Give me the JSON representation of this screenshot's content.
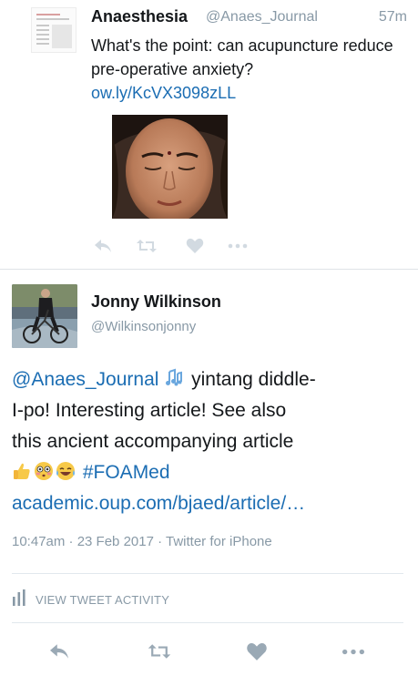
{
  "tweet_1": {
    "author_name": "Anaesthesia",
    "author_handle": "@Anaes_Journal",
    "time": "57m",
    "text": "What's the point: can acupuncture reduce pre-operative anxiety?",
    "link": "ow.ly/KcVX3098zLL",
    "actions": {
      "reply": "reply-icon",
      "retweet": "retweet-icon",
      "like": "heart-icon",
      "more": "more-icon"
    }
  },
  "tweet_2": {
    "author_name": "Jonny Wilkinson",
    "author_handle": "@Wilkinsonjonny",
    "mention": "@Anaes_Journal",
    "line_1_text": "yintang diddle-",
    "line_2_text": "I-po! Interesting article! See also",
    "line_3_text": "this ancient accompanying article",
    "hashtag": "#FOAMed",
    "link": "academic.oup.com/bjaed/article/…",
    "emojis": [
      "music-notes-emoji",
      "thumbs-up-emoji",
      "flushed-face-emoji",
      "tears-of-joy-emoji"
    ],
    "meta": "10:47am · 23 Feb 2017 · Twitter for iPhone",
    "activity_label": "VIEW TWEET ACTIVITY",
    "actions": {
      "reply": "reply-icon",
      "retweet": "retweet-icon",
      "like": "heart-icon",
      "more": "more-icon"
    }
  },
  "colors": {
    "link": "#1b6db3",
    "muted": "#8899a6",
    "action_icon": "#aab8c2",
    "action_icon_dark": "#8899a6",
    "divider": "#e1e8ed"
  }
}
